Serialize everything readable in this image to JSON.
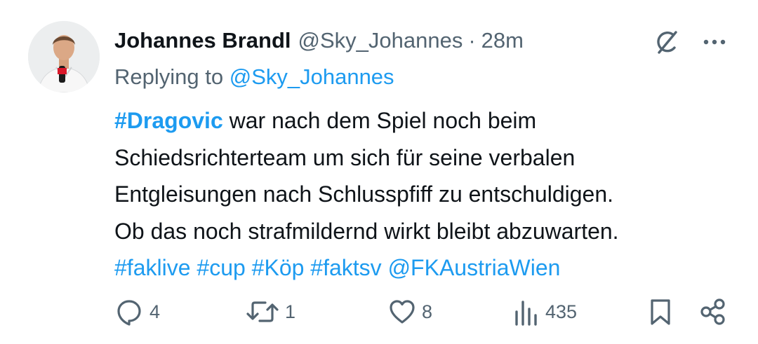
{
  "author": {
    "name": "Johannes Brandl",
    "handle": "@Sky_Johannes",
    "separator": "·",
    "time": "28m"
  },
  "reply": {
    "prefix": "Replying to ",
    "to_handle": "@Sky_Johannes"
  },
  "tweet": {
    "hashtag_main": "#Dragovic",
    "line1_rest": " war nach dem Spiel noch beim",
    "line2": "Schiedsrichterteam um sich für seine verbalen",
    "line3": "Entgleisungen nach Schlusspfiff zu entschuldigen.",
    "line4": "Ob das noch strafmildernd wirkt bleibt abzuwarten.",
    "tags": [
      "#faklive",
      "#cup",
      "#Köp",
      "#faktsv",
      "@FKAustriaWien"
    ]
  },
  "actions": {
    "replies": "4",
    "retweets": "1",
    "likes": "8",
    "views": "435"
  },
  "icons": {
    "grok": "grok-icon",
    "more": "more-icon",
    "reply": "reply-icon",
    "retweet": "retweet-icon",
    "like": "heart-icon",
    "views": "views-icon",
    "bookmark": "bookmark-icon",
    "share": "share-icon"
  },
  "colors": {
    "text": "#0f1419",
    "secondary": "#536471",
    "link": "#1d9bf0"
  }
}
